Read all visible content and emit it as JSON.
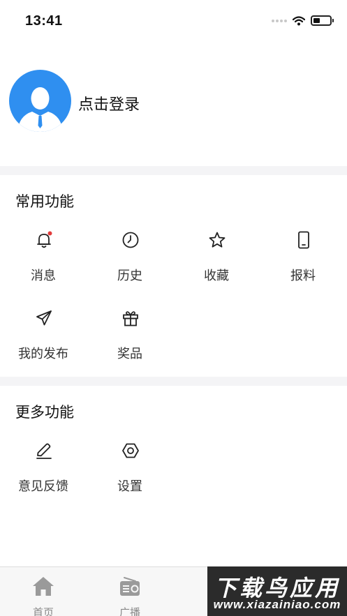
{
  "status_bar": {
    "time": "13:41",
    "battery_level": 0.4
  },
  "profile": {
    "login_label": "点击登录"
  },
  "common": {
    "title": "常用功能",
    "items": [
      {
        "label": "消息",
        "icon": "bell-icon",
        "badge": true
      },
      {
        "label": "历史",
        "icon": "clock-icon"
      },
      {
        "label": "收藏",
        "icon": "star-icon"
      },
      {
        "label": "报料",
        "icon": "phone-icon"
      },
      {
        "label": "我的发布",
        "icon": "send-icon"
      },
      {
        "label": "奖品",
        "icon": "gift-icon"
      }
    ]
  },
  "more": {
    "title": "更多功能",
    "items": [
      {
        "label": "意见反馈",
        "icon": "pencil-icon"
      },
      {
        "label": "设置",
        "icon": "settings-icon"
      }
    ]
  },
  "tabbar": {
    "items": [
      {
        "label": "首页",
        "icon": "home-icon"
      },
      {
        "label": "广播",
        "icon": "radio-icon"
      }
    ]
  },
  "watermark": {
    "title": "下载鸟应用",
    "url": "www.xiazainiao.com"
  },
  "colors": {
    "accent": "#2f8ff0",
    "badge": "#e23b3b",
    "divider": "#f4f4f6",
    "tabbar_bg": "#f7f7f7",
    "tab_icon": "#9a9a9a"
  }
}
